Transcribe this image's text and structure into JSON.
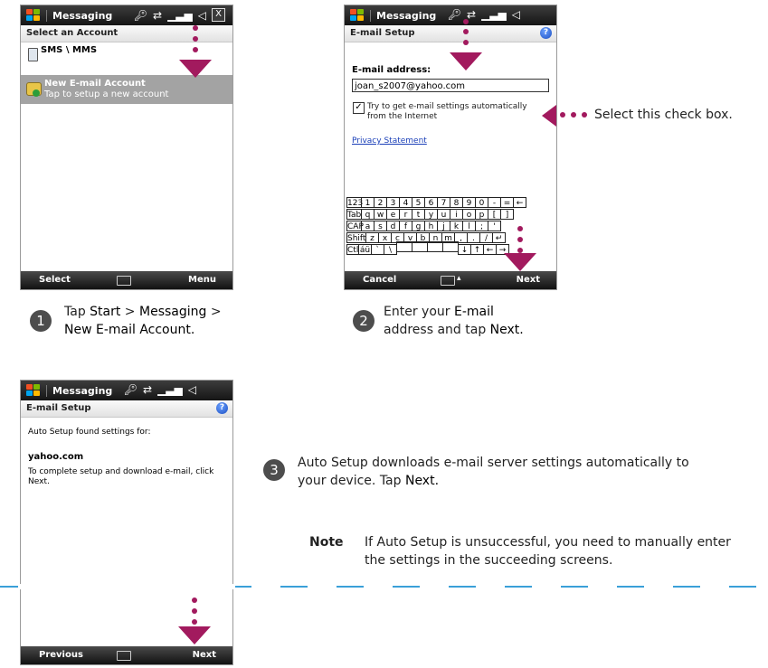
{
  "screen1": {
    "title": "Messaging",
    "close": "X",
    "subtitle": "Select an Account",
    "items": [
      {
        "label": "SMS \\ MMS",
        "sub": ""
      },
      {
        "label": "New E-mail Account",
        "sub": "Tap to setup a new account"
      }
    ],
    "softkeys": {
      "left": "Select",
      "right": "Menu"
    }
  },
  "screen2": {
    "title": "Messaging",
    "subtitle": "E-mail Setup",
    "help": "?",
    "field_label": "E-mail address:",
    "field_value": "joan_s2007@yahoo.com",
    "checkbox_checked": true,
    "checkbox_label_1": "Try to get e-mail settings automatically",
    "checkbox_label_2": "from the Internet",
    "link": "Privacy Statement",
    "keyboard": [
      [
        "123",
        "1",
        "2",
        "3",
        "4",
        "5",
        "6",
        "7",
        "8",
        "9",
        "0",
        "-",
        "=",
        "←"
      ],
      [
        "Tab",
        "q",
        "w",
        "e",
        "r",
        "t",
        "y",
        "u",
        "i",
        "o",
        "p",
        "[",
        "]"
      ],
      [
        "CAP",
        "a",
        "s",
        "d",
        "f",
        "g",
        "h",
        "j",
        "k",
        "l",
        ";",
        "'"
      ],
      [
        "Shift",
        "z",
        "x",
        "c",
        "v",
        "b",
        "n",
        "m",
        ",",
        ".",
        "/",
        "↵"
      ],
      [
        "Ctl",
        "áü",
        "`",
        "\\",
        "",
        "",
        "",
        "",
        "↓",
        "↑",
        "←",
        "→"
      ]
    ],
    "softkeys": {
      "left": "Cancel",
      "right": "Next"
    }
  },
  "screen3": {
    "title": "Messaging",
    "subtitle": "E-mail Setup",
    "help": "?",
    "line1": "Auto Setup found settings for:",
    "domain": "yahoo.com",
    "line2": "To complete setup and download e-mail, click Next.",
    "softkeys": {
      "left": "Previous",
      "right": "Next"
    }
  },
  "callout": "Select this check box.",
  "steps": [
    {
      "num": "1",
      "pre": "Tap ",
      "b1": "Start",
      "mid1": " > ",
      "b2": "Messaging",
      "mid2": " >",
      "line2": "New E-mail Account."
    },
    {
      "num": "2",
      "pre": "Enter your ",
      "b1": "E-mail",
      "line2a": "address",
      "mid": " and tap ",
      "b2": "Next."
    },
    {
      "num": "3",
      "text1": "Auto Setup downloads e-mail server settings automatically to",
      "text2": "your device. Tap ",
      "b": "Next."
    }
  ],
  "note": {
    "label": "Note",
    "text1": "If Auto Setup is unsuccessful, you need to manually enter",
    "text2": "the settings in the succeeding screens."
  },
  "colors": {
    "accent": "#a21a5e",
    "highlight": "#a3a3a3",
    "divider": "#3aa0d8"
  }
}
